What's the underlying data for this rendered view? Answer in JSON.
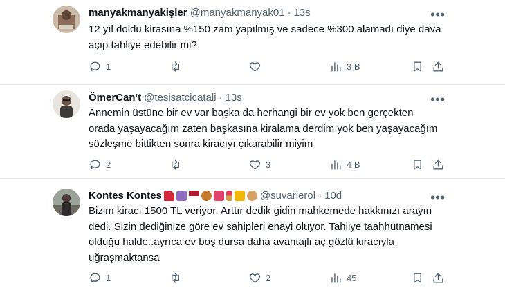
{
  "tweets": [
    {
      "name": "manyakmanyakişler",
      "handle": "@manyakmanyak01",
      "time": "13s",
      "lines": [
        "12 yıl doldu kirasına %150 zam yapılmış ve sadece %300 alamadı diye dava",
        "açıp tahliye edebilir mi?"
      ],
      "replies": "1",
      "retweets": "",
      "likes": "",
      "views": "3 B"
    },
    {
      "name": "ÖmerCan't",
      "handle": "@tesisatcicatali",
      "time": "13s",
      "lines": [
        "Annemin üstüne bir ev var başka da herhangi bir ev yok ben gerçekten",
        "orada yaşayacağım zaten başkasına kiralama derdim yok ben yaşayacağım",
        "sözleşme bittikten sonra kiracıyı çıkarabilir miyim"
      ],
      "replies": "2",
      "retweets": "",
      "likes": "3",
      "views": "4 B"
    },
    {
      "name": "Kontes Kontes",
      "name_emojis": [
        "high-heel",
        "handbag",
        "wine-glass",
        "violin",
        "purse",
        "lipstick",
        "crown",
        "palette"
      ],
      "handle": "@suvarierol",
      "time": "10d",
      "lines": [
        "Bizim kiracı 1500 TL veriyor. Arttır dedik gidin mahkemede hakkınızı arayın",
        "dedi. Sizin dediğinize göre ev sahipleri enayi oluyor. Tahliye taahhütnamesi",
        "olduğu halde..ayrıca ev boş dursa daha avantajlı aç gözlü kiracıyla",
        "uğraşmaktansa"
      ],
      "replies": "1",
      "retweets": "",
      "likes": "2",
      "views": "45"
    }
  ],
  "ui": {
    "separator": "·",
    "more_glyph": "•••"
  },
  "colors": {
    "text": "#0f1419",
    "secondary": "#536471",
    "divider": "#eff3f4"
  }
}
